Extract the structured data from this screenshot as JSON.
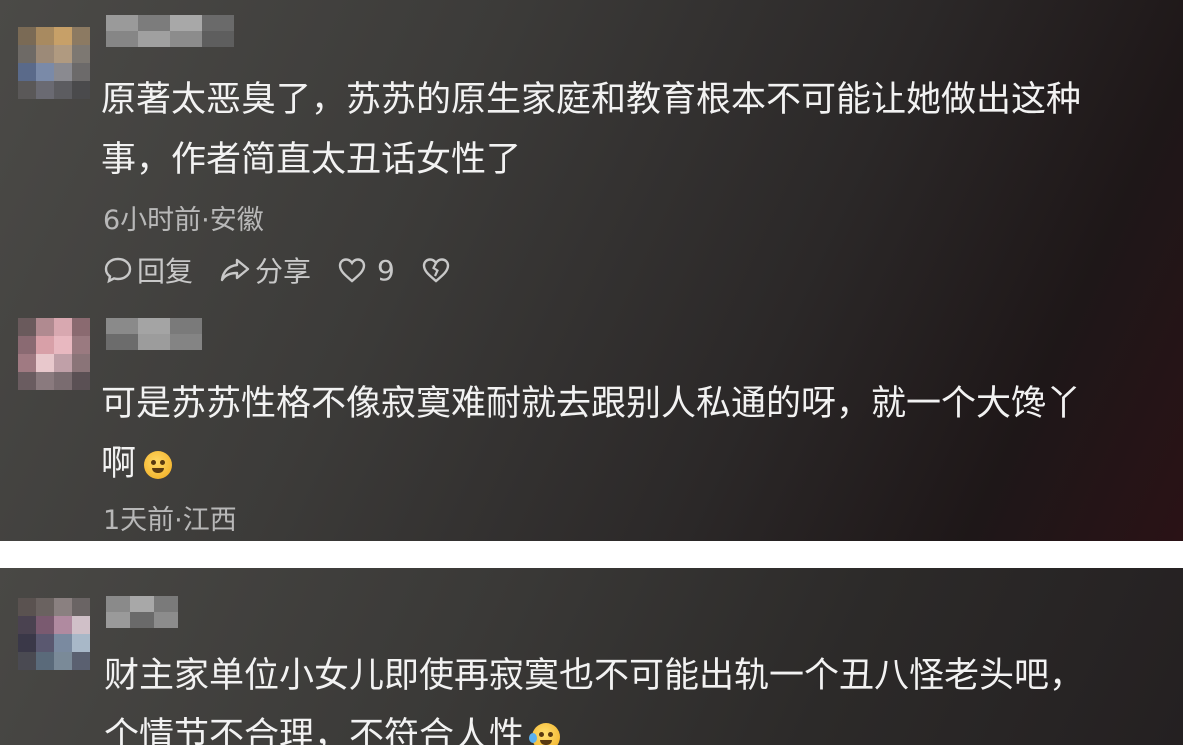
{
  "comments": [
    {
      "text_line1": "原著太恶臭了，苏苏的原生家庭和教育根本不可能让她做出这种",
      "text_line2": "事，作者简直太丑话女性了",
      "meta": "6小时前·安徽",
      "actions": {
        "reply_label": "回复",
        "share_label": "分享",
        "like_count": "9"
      },
      "avatar_colors": [
        "#7a6a55",
        "#a88a60",
        "#c7a068",
        "#8c7a62",
        "#6e6a66",
        "#9c8a78",
        "#b09a80",
        "#7d7872",
        "#5a6a8a",
        "#7a8aa8",
        "#8a8a90",
        "#6c6a6a",
        "#5a5858",
        "#6a6a72",
        "#5c5c60",
        "#4a4a4c"
      ]
    },
    {
      "text_line1": "可是苏苏性格不像寂寞难耐就去跟别人私通的呀，就一个大馋丫",
      "text_line2": "啊",
      "meta": "1天前·江西",
      "avatar_colors": [
        "#6a5a5c",
        "#b08a90",
        "#d8a8b0",
        "#8a6a70",
        "#8a6a72",
        "#d8a0a8",
        "#e8b8c0",
        "#9a7a80",
        "#a07a82",
        "#e8c8cc",
        "#c0a0a8",
        "#8a7478",
        "#6a5c60",
        "#8a7a7e",
        "#7a6c70",
        "#5a5054"
      ]
    },
    {
      "text_line1": "财主家单位小女儿即使再寂寞也不可能出轨一个丑八怪老头吧，",
      "text_line2": "个情节不合理，不符合人性",
      "avatar_colors": [
        "#5a5250",
        "#6a6260",
        "#8a8080",
        "#6a6464",
        "#4a4250",
        "#7a5a70",
        "#b08aa0",
        "#d0c0c8",
        "#3a3848",
        "#5a5870",
        "#7a8aa0",
        "#a8b8c8",
        "#4a4a52",
        "#5a6a7a",
        "#7a8a98",
        "#5a6070"
      ]
    }
  ],
  "colors": {
    "background_dark": "#2b2828",
    "text_primary": "#f2f2f2",
    "text_secondary": "#b8b8b8"
  }
}
